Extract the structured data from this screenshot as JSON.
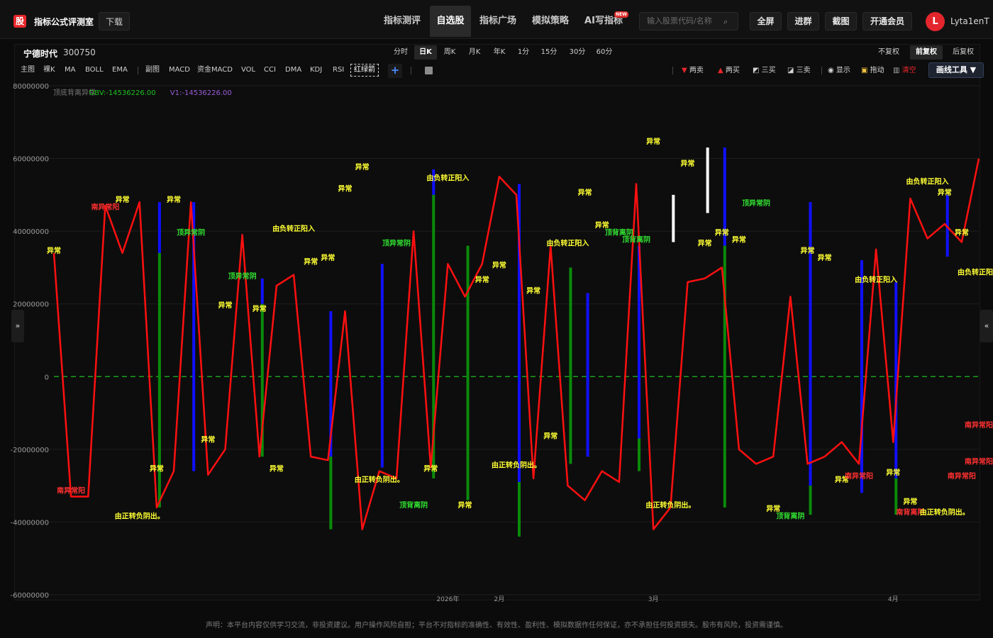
{
  "app": {
    "logo_char": "股",
    "title": "指标公式评测室",
    "download": "下载"
  },
  "nav": [
    {
      "label": "指标测评",
      "active": false
    },
    {
      "label": "自选股",
      "active": true
    },
    {
      "label": "指标广场",
      "active": false
    },
    {
      "label": "模拟策略",
      "active": false
    },
    {
      "label": "AI写指标",
      "active": false
    }
  ],
  "new_badge": "NEW",
  "search": {
    "placeholder": "输入股票代码/名称"
  },
  "header_buttons": [
    "全屏",
    "进群",
    "截图",
    "开通会员"
  ],
  "user": {
    "avatar": "L",
    "name": "Lyta1enT"
  },
  "stock": {
    "name": "宁德时代",
    "code": "300750"
  },
  "periods": [
    {
      "label": "分时",
      "active": false
    },
    {
      "label": "日K",
      "active": true
    },
    {
      "label": "周K",
      "active": false
    },
    {
      "label": "月K",
      "active": false
    },
    {
      "label": "年K",
      "active": false
    },
    {
      "label": "1分",
      "active": false
    },
    {
      "label": "15分",
      "active": false
    },
    {
      "label": "30分",
      "active": false
    },
    {
      "label": "60分",
      "active": false
    }
  ],
  "adjust": [
    {
      "label": "不复权",
      "active": false
    },
    {
      "label": "前复权",
      "active": true
    },
    {
      "label": "后复权",
      "active": false
    }
  ],
  "indicators_main": [
    "主图",
    "裸K",
    "MA",
    "BOLL",
    "EMA"
  ],
  "indicators_sub": [
    "副图",
    "MACD",
    "资金MACD",
    "VOL",
    "CCI",
    "DMA",
    "KDJ",
    "RSI"
  ],
  "indicator_boxed": "红绿箭",
  "add_symbol": "+",
  "tools": [
    {
      "icon": "▼",
      "label": "两卖",
      "color": "#e8262b"
    },
    {
      "icon": "▲",
      "label": "两买",
      "color": "#e8262b"
    },
    {
      "icon": "◩",
      "label": "三买",
      "color": "#dddddd"
    },
    {
      "icon": "◪",
      "label": "三卖",
      "color": "#dddddd"
    },
    {
      "icon": "◉",
      "label": "显示",
      "color": "#dddddd"
    },
    {
      "icon": "▣",
      "label": "拖动",
      "color": "#f0c040"
    },
    {
      "icon": "▥",
      "label": "清空",
      "color": "#e8262b"
    }
  ],
  "draw_tool": "画线工具 ▼",
  "side_left": "»",
  "side_right": "«",
  "footer": "声明：本平台内容仅供学习交流，非投资建议。用户操作风险自担；平台不对指标的准确性、有效性、盈利性、模拟数据作任何保证，亦不承担任何投资损失。股市有风险，投资需谨慎。",
  "chart_data": {
    "type": "line",
    "legend": [
      {
        "text": "顶底背离异常",
        "color": "#777777"
      },
      {
        "text": "OBV:-14536226.00",
        "color": "#1fc01f"
      },
      {
        "text": "V1:-14536226.00",
        "color": "#9b5bd6"
      }
    ],
    "ylim": [
      -60000000,
      80000000
    ],
    "yticks": [
      "80000000",
      "60000000",
      "40000000",
      "20000000",
      "0",
      "-20000000",
      "-40000000",
      "-60000000"
    ],
    "ytick_values": [
      80000000,
      60000000,
      40000000,
      20000000,
      0,
      -20000000,
      -40000000,
      -60000000
    ],
    "xticks": [
      {
        "i": 23,
        "label": "2026年"
      },
      {
        "i": 26,
        "label": "2月"
      },
      {
        "i": 35,
        "label": "3月"
      },
      {
        "i": 49,
        "label": "4月"
      }
    ],
    "n": 55,
    "series": [
      {
        "name": "OBV",
        "color": "#ff1010",
        "values": [
          34000000,
          -33000000,
          -33000000,
          47000000,
          34000000,
          48000000,
          -36000000,
          -26000000,
          48000000,
          -27000000,
          -20000000,
          39000000,
          -22000000,
          25000000,
          28000000,
          -22000000,
          -23000000,
          18000000,
          -42000000,
          -26000000,
          -28000000,
          40000000,
          -25000000,
          31000000,
          22000000,
          31000000,
          55000000,
          50000000,
          -28000000,
          36000000,
          -30000000,
          -34000000,
          -26000000,
          -29000000,
          53000000,
          -42000000,
          -36000000,
          26000000,
          27000000,
          30000000,
          -20000000,
          -24000000,
          -22000000,
          22000000,
          -24000000,
          -22000000,
          -18000000,
          -24000000,
          35000000,
          -18000000,
          49000000,
          38000000,
          42000000,
          37000000,
          60000000
        ]
      }
    ],
    "bars": [
      {
        "i": 6,
        "from": 48000000,
        "to": 34000000,
        "color": "#1010ff"
      },
      {
        "i": 6,
        "from": 34000000,
        "to": -36000000,
        "color": "#0a8a0a"
      },
      {
        "i": 8,
        "from": 48000000,
        "to": -26000000,
        "color": "#1010ff"
      },
      {
        "i": 12,
        "from": 27000000,
        "to": 20000000,
        "color": "#1010ff"
      },
      {
        "i": 12,
        "from": 20000000,
        "to": -22000000,
        "color": "#0a8a0a"
      },
      {
        "i": 16,
        "from": 18000000,
        "to": -22000000,
        "color": "#1010ff"
      },
      {
        "i": 16,
        "from": -22000000,
        "to": -42000000,
        "color": "#0a8a0a"
      },
      {
        "i": 19,
        "from": 31000000,
        "to": -25000000,
        "color": "#1010ff"
      },
      {
        "i": 22,
        "from": 57000000,
        "to": 50000000,
        "color": "#1010ff"
      },
      {
        "i": 22,
        "from": 50000000,
        "to": -28000000,
        "color": "#0a8a0a"
      },
      {
        "i": 24,
        "from": 36000000,
        "to": -34000000,
        "color": "#0a8a0a"
      },
      {
        "i": 27,
        "from": 53000000,
        "to": -29000000,
        "color": "#1010ff"
      },
      {
        "i": 27,
        "from": -29000000,
        "to": -44000000,
        "color": "#0a8a0a"
      },
      {
        "i": 30,
        "from": 30000000,
        "to": -24000000,
        "color": "#0a8a0a"
      },
      {
        "i": 31,
        "from": 23000000,
        "to": -22000000,
        "color": "#1010ff"
      },
      {
        "i": 34,
        "from": 36000000,
        "to": -17000000,
        "color": "#1010ff"
      },
      {
        "i": 34,
        "from": -17000000,
        "to": -26000000,
        "color": "#0a8a0a"
      },
      {
        "i": 36,
        "from": 50000000,
        "to": 37000000,
        "color": "#ffffff"
      },
      {
        "i": 38,
        "from": 63000000,
        "to": 45000000,
        "color": "#ffffff"
      },
      {
        "i": 39,
        "from": 63000000,
        "to": 36000000,
        "color": "#1010ff"
      },
      {
        "i": 39,
        "from": 36000000,
        "to": -36000000,
        "color": "#0a8a0a"
      },
      {
        "i": 44,
        "from": 48000000,
        "to": -30000000,
        "color": "#1010ff"
      },
      {
        "i": 44,
        "from": -30000000,
        "to": -38000000,
        "color": "#0a8a0a"
      },
      {
        "i": 47,
        "from": 32000000,
        "to": -32000000,
        "color": "#1010ff"
      },
      {
        "i": 49,
        "from": 26000000,
        "to": -28000000,
        "color": "#1010ff"
      },
      {
        "i": 49,
        "from": -28000000,
        "to": -38000000,
        "color": "#0a8a0a"
      },
      {
        "i": 52,
        "from": 50000000,
        "to": 33000000,
        "color": "#1010ff"
      }
    ],
    "annotations": [
      {
        "i": 0,
        "v": 34000000,
        "text": "异常",
        "color": "#ffff33"
      },
      {
        "i": 1,
        "v": -32000000,
        "text": "南异常阳",
        "color": "#ff3030"
      },
      {
        "i": 3,
        "v": 46000000,
        "text": "南异常阳",
        "color": "#ff3030"
      },
      {
        "i": 4,
        "v": 48000000,
        "text": "异常",
        "color": "#ffff33"
      },
      {
        "i": 5,
        "v": -39000000,
        "text": "由正转负阴出。",
        "color": "#ffff33"
      },
      {
        "i": 6,
        "v": -26000000,
        "text": "异常",
        "color": "#ffff33"
      },
      {
        "i": 7,
        "v": 48000000,
        "text": "异常",
        "color": "#ffff33"
      },
      {
        "i": 8,
        "v": 39000000,
        "text": "顶异常阴",
        "color": "#30e030"
      },
      {
        "i": 9,
        "v": -18000000,
        "text": "异常",
        "color": "#ffff33"
      },
      {
        "i": 10,
        "v": 19000000,
        "text": "异常",
        "color": "#ffff33"
      },
      {
        "i": 11,
        "v": 27000000,
        "text": "顶异常阴",
        "color": "#30e030"
      },
      {
        "i": 12,
        "v": 18000000,
        "text": "异常",
        "color": "#ffff33"
      },
      {
        "i": 13,
        "v": -26000000,
        "text": "异常",
        "color": "#ffff33"
      },
      {
        "i": 14,
        "v": 40000000,
        "text": "由负转正阳入",
        "color": "#ffff33"
      },
      {
        "i": 15,
        "v": 31000000,
        "text": "异常",
        "color": "#ffff33"
      },
      {
        "i": 16,
        "v": 32000000,
        "text": "异常",
        "color": "#ffff33"
      },
      {
        "i": 17,
        "v": 51000000,
        "text": "异常",
        "color": "#ffff33"
      },
      {
        "i": 18,
        "v": 57000000,
        "text": "异常",
        "color": "#ffff33"
      },
      {
        "i": 19,
        "v": -29000000,
        "text": "由正转负阴出。",
        "color": "#ffff33"
      },
      {
        "i": 20,
        "v": 36000000,
        "text": "顶异常阴",
        "color": "#30e030"
      },
      {
        "i": 21,
        "v": -36000000,
        "text": "顶背离阴",
        "color": "#30e030"
      },
      {
        "i": 22,
        "v": -26000000,
        "text": "异常",
        "color": "#ffff33"
      },
      {
        "i": 23,
        "v": 54000000,
        "text": "由负转正阳入",
        "color": "#ffff33"
      },
      {
        "i": 24,
        "v": -36000000,
        "text": "异常",
        "color": "#ffff33"
      },
      {
        "i": 25,
        "v": 26000000,
        "text": "异常",
        "color": "#ffff33"
      },
      {
        "i": 26,
        "v": 30000000,
        "text": "异常",
        "color": "#ffff33"
      },
      {
        "i": 27,
        "v": -25000000,
        "text": "由正转负阴出。",
        "color": "#ffff33"
      },
      {
        "i": 28,
        "v": 23000000,
        "text": "异常",
        "color": "#ffff33"
      },
      {
        "i": 29,
        "v": -17000000,
        "text": "异常",
        "color": "#ffff33"
      },
      {
        "i": 30,
        "v": 36000000,
        "text": "由负转正阳入",
        "color": "#ffff33"
      },
      {
        "i": 31,
        "v": 50000000,
        "text": "异常",
        "color": "#ffff33"
      },
      {
        "i": 32,
        "v": 41000000,
        "text": "异常",
        "color": "#ffff33"
      },
      {
        "i": 33,
        "v": 39000000,
        "text": "顶背离阴",
        "color": "#30e030"
      },
      {
        "i": 34,
        "v": 37000000,
        "text": "顶背离阴",
        "color": "#30e030"
      },
      {
        "i": 35,
        "v": 64000000,
        "text": "异常",
        "color": "#ffff33"
      },
      {
        "i": 36,
        "v": -36000000,
        "text": "由正转负阴出。",
        "color": "#ffff33"
      },
      {
        "i": 37,
        "v": 58000000,
        "text": "异常",
        "color": "#ffff33"
      },
      {
        "i": 38,
        "v": 36000000,
        "text": "异常",
        "color": "#ffff33"
      },
      {
        "i": 39,
        "v": 39000000,
        "text": "异常",
        "color": "#ffff33"
      },
      {
        "i": 40,
        "v": 37000000,
        "text": "异常",
        "color": "#ffff33"
      },
      {
        "i": 41,
        "v": 47000000,
        "text": "顶异常阴",
        "color": "#30e030"
      },
      {
        "i": 42,
        "v": -37000000,
        "text": "异常",
        "color": "#ffff33"
      },
      {
        "i": 43,
        "v": -39000000,
        "text": "顶背离阴",
        "color": "#30e030"
      },
      {
        "i": 44,
        "v": 34000000,
        "text": "异常",
        "color": "#ffff33"
      },
      {
        "i": 45,
        "v": 32000000,
        "text": "异常",
        "color": "#ffff33"
      },
      {
        "i": 46,
        "v": -29000000,
        "text": "异常",
        "color": "#ffff33"
      },
      {
        "i": 47,
        "v": -28000000,
        "text": "南异常阳",
        "color": "#ff3030"
      },
      {
        "i": 48,
        "v": 26000000,
        "text": "由负转正阳入",
        "color": "#ffff33"
      },
      {
        "i": 49,
        "v": -27000000,
        "text": "异常",
        "color": "#ffff33"
      },
      {
        "i": 50,
        "v": -35000000,
        "text": "异常",
        "color": "#ffff33"
      },
      {
        "i": 50,
        "v": -38000000,
        "text": "南背离阳",
        "color": "#ff3030"
      },
      {
        "i": 51,
        "v": 53000000,
        "text": "由负转正阳入",
        "color": "#ffff33"
      },
      {
        "i": 52,
        "v": 50000000,
        "text": "异常",
        "color": "#ffff33"
      },
      {
        "i": 52,
        "v": -38000000,
        "text": "由正转负阴出。",
        "color": "#ffff33"
      },
      {
        "i": 53,
        "v": 39000000,
        "text": "异常",
        "color": "#ffff33"
      },
      {
        "i": 53,
        "v": -28000000,
        "text": "南异常阳",
        "color": "#ff3030"
      },
      {
        "i": 54,
        "v": 28000000,
        "text": "由负转正阳入",
        "color": "#ffff33"
      },
      {
        "i": 54,
        "v": -24000000,
        "text": "南异常阳",
        "color": "#ff3030"
      },
      {
        "i": 54,
        "v": -14000000,
        "text": "南异常阳",
        "color": "#ff3030"
      }
    ]
  }
}
